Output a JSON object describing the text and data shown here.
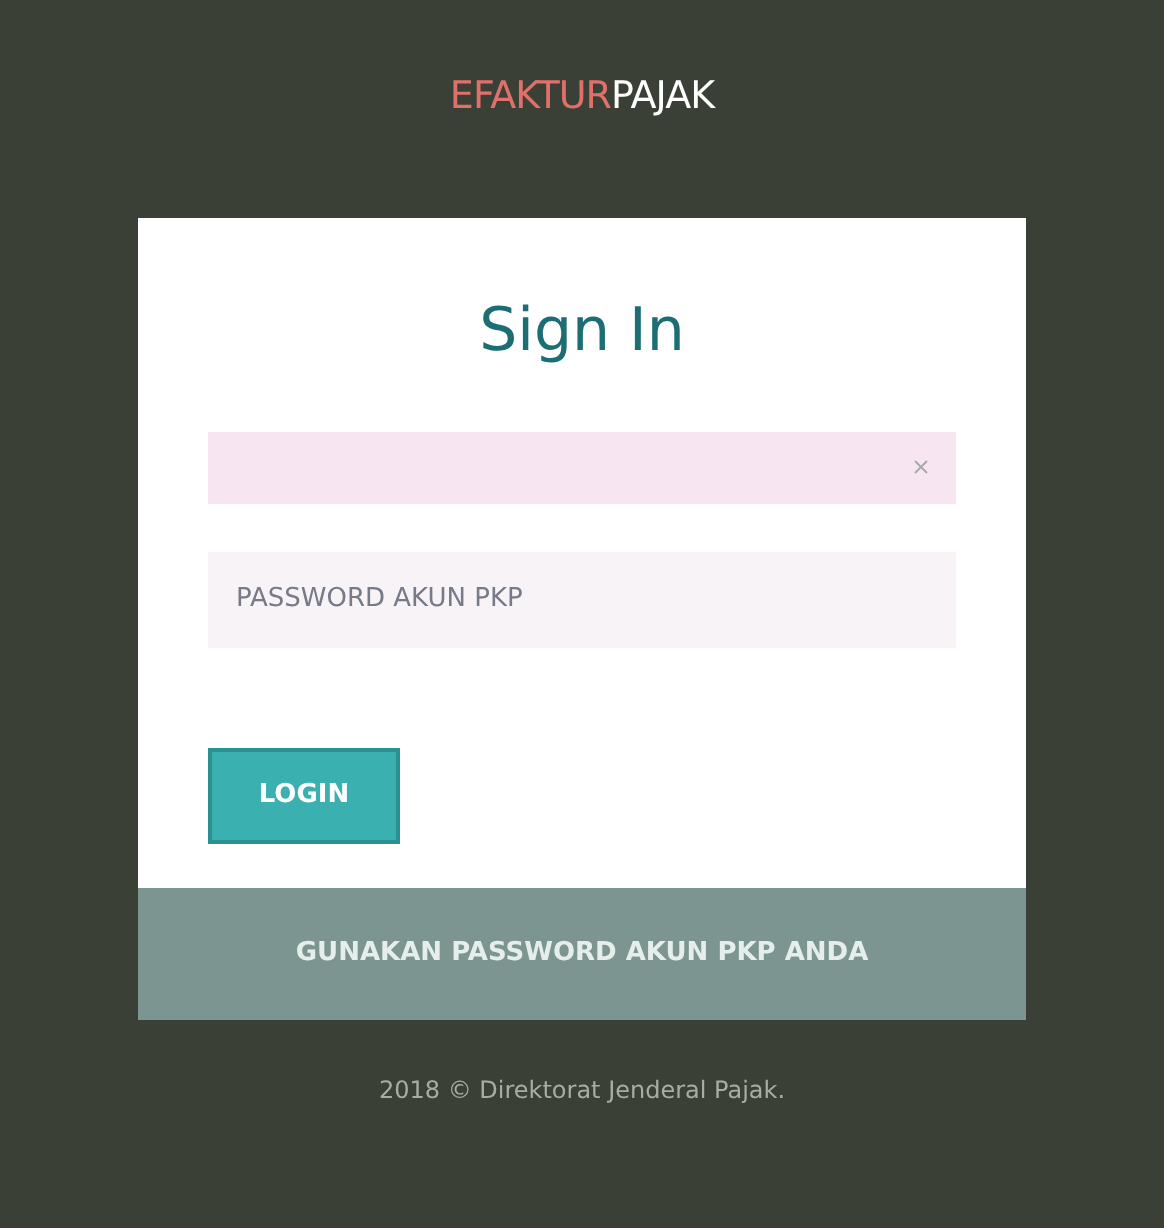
{
  "logo": {
    "parts": [
      {
        "text": "EFAKTUR",
        "color": "#e0706a"
      },
      {
        "text": "PAJAK",
        "color": "#ffffff"
      }
    ]
  },
  "login_card": {
    "title": "Sign In",
    "fields": [
      {
        "kind": "clearable"
      },
      {
        "kind": "password",
        "placeholder": "PASSWORD AKUN PKP"
      }
    ],
    "button": "LOGIN",
    "footer_note": "GUNAKAN PASSWORD AKUN PKP ANDA"
  },
  "copyright": "2018 © Direktorat Jenderal Pajak."
}
